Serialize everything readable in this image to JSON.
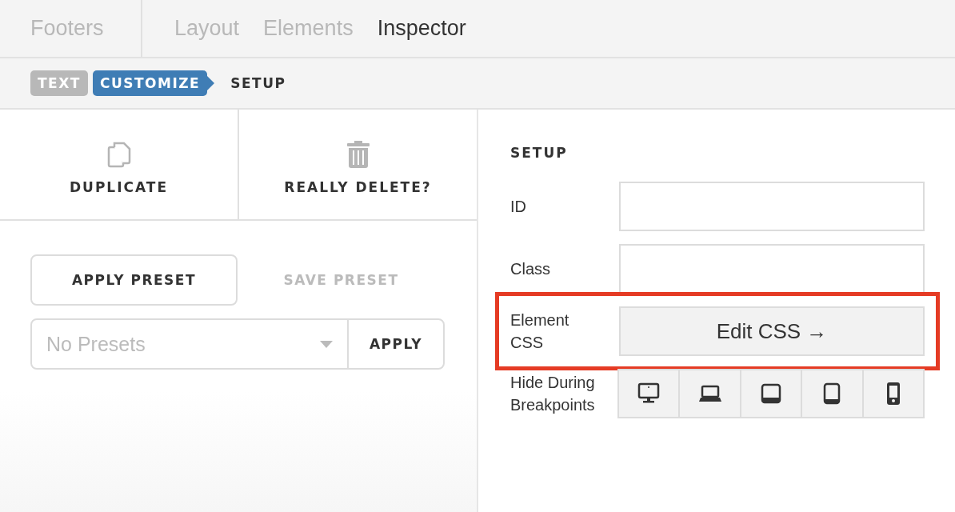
{
  "top_tabs": [
    {
      "label": "Footers",
      "selected": false
    },
    {
      "label": "Layout",
      "selected": false
    },
    {
      "label": "Elements",
      "selected": false
    },
    {
      "label": "Inspector",
      "selected": true
    }
  ],
  "breadcrumbs": [
    {
      "label": "TEXT",
      "kind": "past"
    },
    {
      "label": "CUSTOMIZE",
      "kind": "current"
    },
    {
      "label": "SETUP",
      "kind": "next"
    }
  ],
  "actions": [
    {
      "label": "DUPLICATE"
    },
    {
      "label": "REALLY DELETE?"
    }
  ],
  "preset_tabs": [
    {
      "label": "APPLY PRESET",
      "selected": true
    },
    {
      "label": "SAVE PRESET",
      "selected": false
    }
  ],
  "preset_select": {
    "placeholder": "No Presets",
    "button": "APPLY"
  },
  "setup": {
    "title": "SETUP",
    "fields": [
      {
        "label": "ID",
        "kind": "input",
        "highlighted": false
      },
      {
        "label": "Class",
        "kind": "input",
        "highlighted": false
      },
      {
        "label": "Element CSS",
        "kind": "button",
        "button": "Edit CSS →",
        "highlighted": true
      },
      {
        "label": "Hide During Breakpoints",
        "kind": "breakpoints",
        "highlighted": false,
        "devices": [
          {
            "on": false
          },
          {
            "on": false
          },
          {
            "on": false
          },
          {
            "on": false
          },
          {
            "on": false
          }
        ]
      }
    ]
  }
}
